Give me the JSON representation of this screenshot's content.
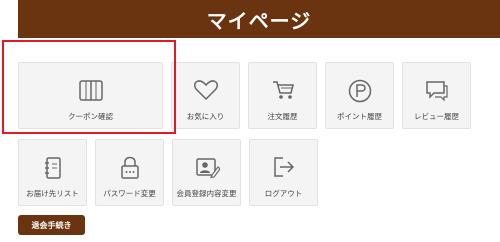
{
  "header": {
    "title": "マイページ"
  },
  "menu": {
    "row1": [
      {
        "label": "クーポン確認",
        "icon": "book-icon"
      },
      {
        "label": "お気に入り",
        "icon": "heart-icon"
      },
      {
        "label": "注文履歴",
        "icon": "cart-icon"
      },
      {
        "label": "ポイント履歴",
        "icon": "point-icon"
      },
      {
        "label": "レビュー履歴",
        "icon": "speech-bubble-icon"
      }
    ],
    "row2": [
      {
        "label": "お届け先リスト",
        "icon": "address-book-icon"
      },
      {
        "label": "パスワード変更",
        "icon": "lock-icon"
      },
      {
        "label": "会員登録内容変更",
        "icon": "profile-edit-icon"
      },
      {
        "label": "ログアウト",
        "icon": "logout-icon"
      }
    ]
  },
  "withdraw_button": {
    "label": "退会手続き"
  },
  "colors": {
    "brand": "#6b3410",
    "highlight": "#e11b24",
    "tile_bg": "#f4f4f4",
    "icon": "#666666"
  }
}
